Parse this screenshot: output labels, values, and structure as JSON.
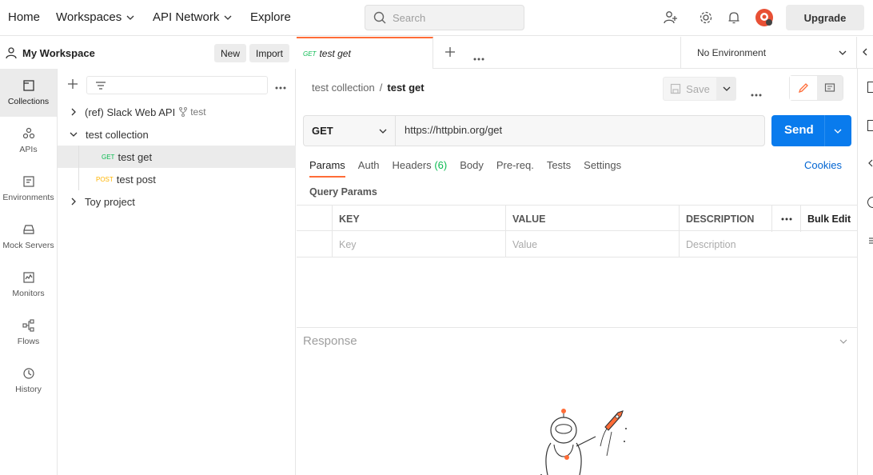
{
  "topnav": {
    "home": "Home",
    "workspaces": "Workspaces",
    "api_network": "API Network",
    "explore": "Explore",
    "search_placeholder": "Search",
    "upgrade": "Upgrade"
  },
  "workspace": {
    "title": "My Workspace",
    "new_label": "New",
    "import_label": "Import"
  },
  "iconbar": [
    {
      "label": "Collections",
      "icon": "collections-icon"
    },
    {
      "label": "APIs",
      "icon": "apis-icon"
    },
    {
      "label": "Environments",
      "icon": "environments-icon"
    },
    {
      "label": "Mock Servers",
      "icon": "mock-servers-icon"
    },
    {
      "label": "Monitors",
      "icon": "monitors-icon"
    },
    {
      "label": "Flows",
      "icon": "flows-icon"
    },
    {
      "label": "History",
      "icon": "history-icon"
    }
  ],
  "tree": {
    "ref_collection": "(ref) Slack Web API",
    "ref_fork": "test",
    "collection": "test collection",
    "req1_method": "GET",
    "req1_name": "test get",
    "req2_method": "POST",
    "req2_name": "test post",
    "toy": "Toy project"
  },
  "tab": {
    "method": "GET",
    "name": "test get"
  },
  "environment": "No Environment",
  "breadcrumb": {
    "collection": "test collection",
    "separator": "/",
    "request": "test get"
  },
  "save_label": "Save",
  "request": {
    "method": "GET",
    "url": "https://httpbin.org/get",
    "send": "Send"
  },
  "req_tabs": {
    "params": "Params",
    "auth": "Auth",
    "headers": "Headers",
    "headers_count": "(6)",
    "body": "Body",
    "prereq": "Pre-req.",
    "tests": "Tests",
    "settings": "Settings",
    "cookies": "Cookies"
  },
  "query_params": {
    "title": "Query Params",
    "col_key": "KEY",
    "col_value": "VALUE",
    "col_description": "DESCRIPTION",
    "bulk_edit": "Bulk Edit",
    "ph_key": "Key",
    "ph_value": "Value",
    "ph_description": "Description"
  },
  "response_label": "Response",
  "colors": {
    "accent": "#ff6c37",
    "send": "#097bed",
    "get": "#0cbb52",
    "post": "#ffb400",
    "link": "#0265d2"
  }
}
